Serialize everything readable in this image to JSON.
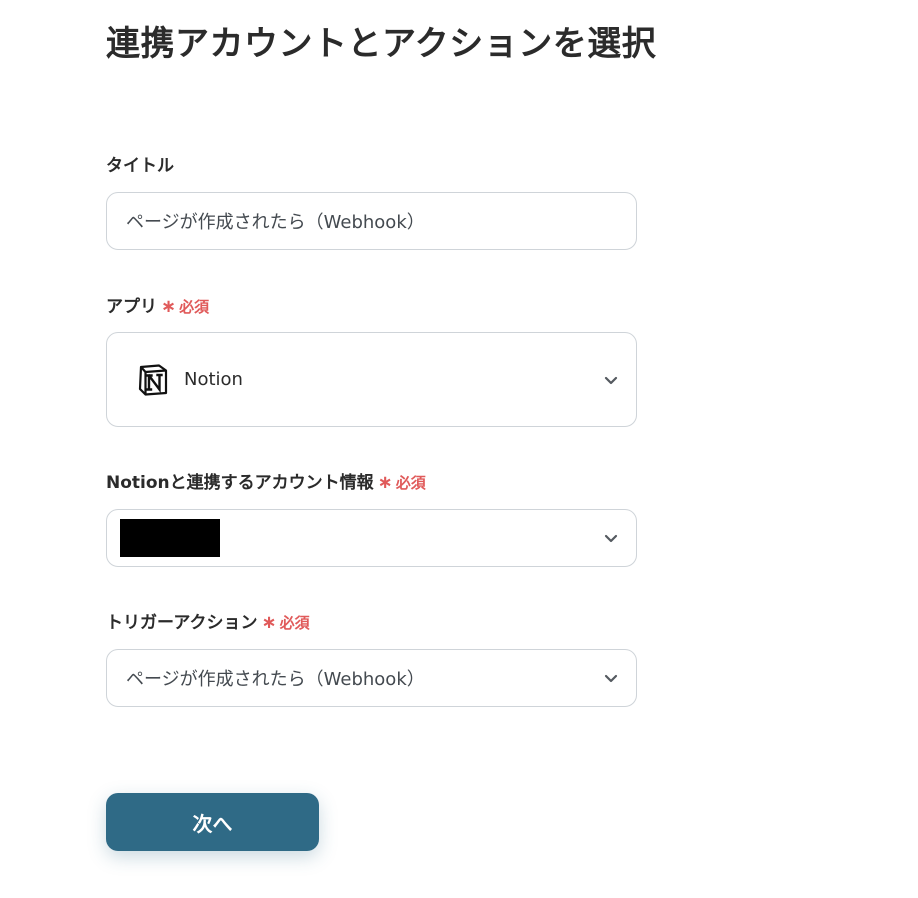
{
  "page": {
    "title": "連携アカウントとアクションを選択"
  },
  "form": {
    "title_field": {
      "label": "タイトル",
      "value": "ページが作成されたら（Webhook）"
    },
    "app_field": {
      "label": "アプリ",
      "required_label": "必須",
      "selected_app": "Notion",
      "icon": "notion-logo-icon"
    },
    "account_field": {
      "label": "Notionと連携するアカウント情報",
      "required_label": "必須",
      "selected_value_redacted": true
    },
    "trigger_field": {
      "label": "トリガーアクション",
      "required_label": "必須",
      "selected_value": "ページが作成されたら（Webhook）"
    }
  },
  "actions": {
    "next_label": "次へ"
  },
  "colors": {
    "primary_button": "#2f6a86",
    "required_text": "#e05a5a",
    "border": "#cfd4d9"
  }
}
